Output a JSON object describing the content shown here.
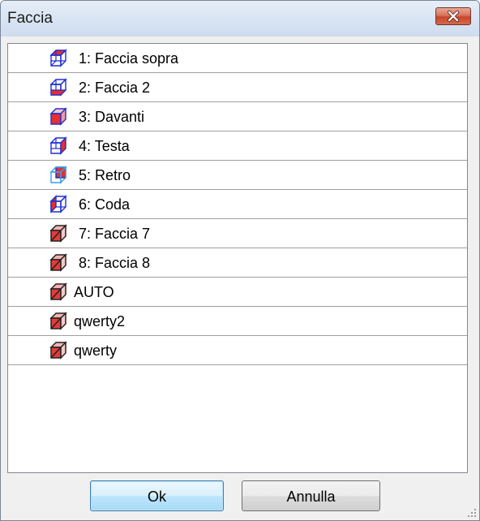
{
  "window": {
    "title": "Faccia"
  },
  "faces": [
    {
      "label": "1: Faccia sopra",
      "icon": "cube-top-face-icon"
    },
    {
      "label": "2: Faccia 2",
      "icon": "cube-face-2-icon"
    },
    {
      "label": "3: Davanti",
      "icon": "cube-front-icon"
    },
    {
      "label": "4: Testa",
      "icon": "cube-head-icon"
    },
    {
      "label": "5: Retro",
      "icon": "cube-back-icon"
    },
    {
      "label": "6: Coda",
      "icon": "cube-tail-icon"
    },
    {
      "label": "7: Faccia 7",
      "icon": "cube-custom-face-icon"
    },
    {
      "label": "8: Faccia 8",
      "icon": "cube-custom-face-icon"
    },
    {
      "label": "AUTO",
      "icon": "cube-custom-face-icon"
    },
    {
      "label": "qwerty2",
      "icon": "cube-custom-face-icon"
    },
    {
      "label": "qwerty",
      "icon": "cube-custom-face-icon"
    }
  ],
  "buttons": {
    "ok": "Ok",
    "cancel": "Annulla"
  },
  "colors": {
    "icon_blue": "#1f2fd0",
    "icon_red": "#e52f2f",
    "icon_outline": "#222222",
    "close_button": "#c7452b",
    "default_button_border": "#3c7fb1"
  }
}
